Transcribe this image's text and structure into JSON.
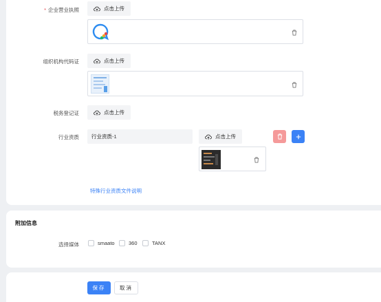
{
  "qualification": {
    "business_license": {
      "label": "企业营业执照",
      "required": true,
      "upload_label": "点击上传"
    },
    "org_code": {
      "label": "组织机构代码证",
      "upload_label": "点击上传"
    },
    "tax_registration": {
      "label": "税务登记证",
      "upload_label": "点击上传"
    },
    "industry": {
      "label": "行业资质",
      "items": [
        {
          "name": "行业资质-1",
          "upload_label": "点击上传"
        }
      ],
      "delete_color": "#f59a9a",
      "add_color": "#3b82f6"
    },
    "special_link": "特殊行业资质文件说明"
  },
  "extra": {
    "title": "附加信息",
    "media_label": "选择媒体",
    "media_options": [
      {
        "label": "smaato",
        "checked": false
      },
      {
        "label": "360",
        "checked": false
      },
      {
        "label": "TANX",
        "checked": false
      }
    ]
  },
  "actions": {
    "save_label": "保存",
    "cancel_label": "取消",
    "primary_color": "#3b82f6"
  },
  "icons": [
    "upload-cloud-icon",
    "trash-icon",
    "plus-icon",
    "app-logo-icon"
  ]
}
